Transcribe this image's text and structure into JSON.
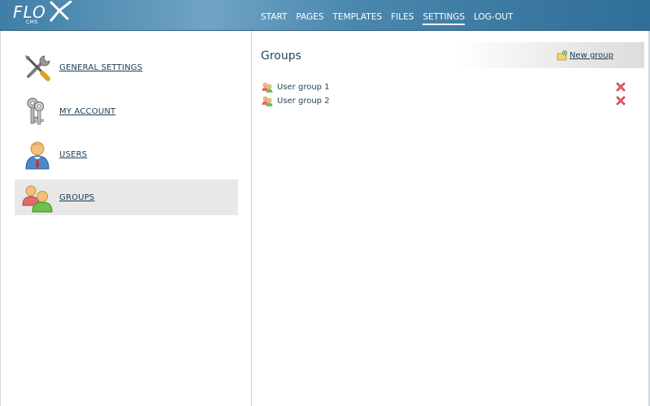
{
  "brand": {
    "logo_text": "FLO",
    "logo_sub": "CMS"
  },
  "nav": {
    "items": [
      {
        "label": "START"
      },
      {
        "label": "PAGES"
      },
      {
        "label": "TEMPLATES"
      },
      {
        "label": "FILES"
      },
      {
        "label": "SETTINGS",
        "active": true
      },
      {
        "label": "LOG-OUT"
      }
    ]
  },
  "sidebar": {
    "items": [
      {
        "label": "GENERAL SETTINGS",
        "icon": "tools-icon"
      },
      {
        "label": "MY ACCOUNT",
        "icon": "keys-icon"
      },
      {
        "label": "USERS",
        "icon": "user-icon"
      },
      {
        "label": "GROUPS",
        "icon": "group-icon",
        "active": true
      }
    ]
  },
  "main": {
    "title": "Groups",
    "new_group_label": "New group",
    "groups": [
      {
        "name": "User group 1"
      },
      {
        "name": "User group 2"
      }
    ]
  },
  "colors": {
    "header_accent": "#4a86ad",
    "text": "#1a3a52",
    "active_item_bg": "#e8e8e8",
    "delete": "#d42020"
  }
}
